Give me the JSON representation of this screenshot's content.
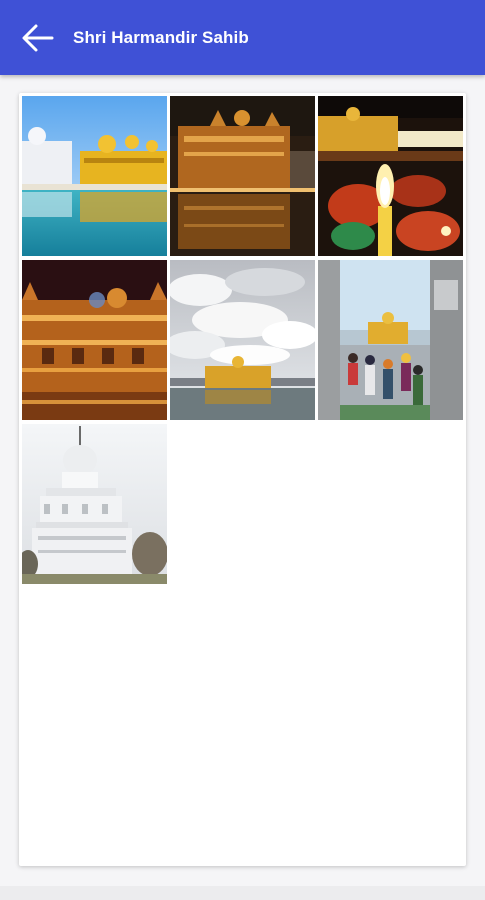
{
  "appbar": {
    "title": "Shri Harmandir Sahib",
    "back_icon": "arrow-left-icon",
    "color": "#3f51d6"
  },
  "gallery": {
    "photos": [
      {
        "name": "photo-golden-temple-day-reflection"
      },
      {
        "name": "photo-golden-temple-night-reflection"
      },
      {
        "name": "photo-golden-temple-diyas"
      },
      {
        "name": "photo-golden-temple-illuminated"
      },
      {
        "name": "photo-golden-temple-cloudy-sky"
      },
      {
        "name": "photo-golden-temple-pilgrims"
      },
      {
        "name": "photo-white-gurdwara-tower"
      }
    ]
  }
}
